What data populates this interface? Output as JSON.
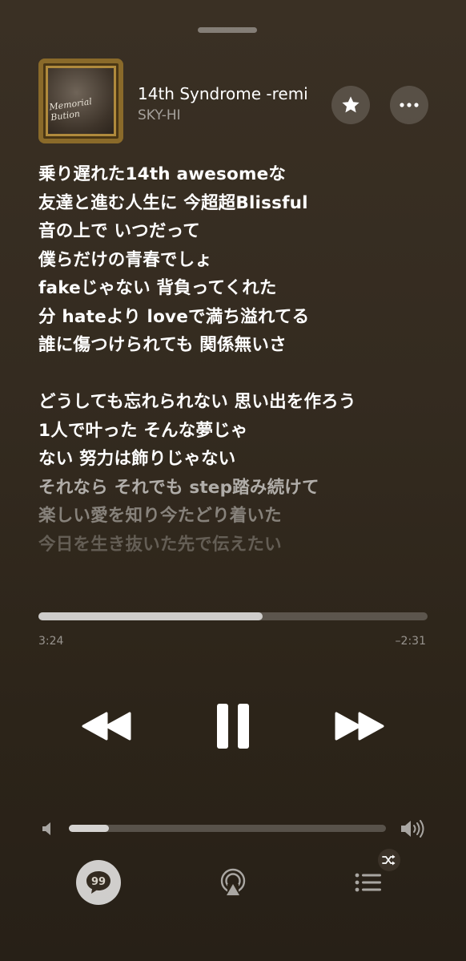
{
  "now_playing": {
    "title": "14th Syndrome -remi",
    "artist": "SKY-HI",
    "album_art_text": "Memorial Bution"
  },
  "lyrics": [
    {
      "text": "乗り遅れた14th awesomeな",
      "opacity": 1
    },
    {
      "text": "友達と進む人生に 今超超Blissful",
      "opacity": 1
    },
    {
      "text": "音の上で いつだって",
      "opacity": 1
    },
    {
      "text": "僕らだけの青春でしょ",
      "opacity": 1
    },
    {
      "text": "fakeじゃない 背負ってくれた",
      "opacity": 1
    },
    {
      "text": "分 hateより loveで満ち溢れてる",
      "opacity": 1
    },
    {
      "text": "誰に傷つけられても 関係無いさ",
      "opacity": 1
    },
    {
      "text": "",
      "opacity": 1
    },
    {
      "text": "どうしても忘れられない 思い出を作ろう",
      "opacity": 1
    },
    {
      "text": "1人で叶った そんな夢じゃ",
      "opacity": 1
    },
    {
      "text": "ない 努力は飾りじゃない",
      "opacity": 1
    },
    {
      "text": "それなら それでも step踏み続けて",
      "opacity": 0.62
    },
    {
      "text": "楽しい愛を知り今たどり着いた",
      "opacity": 0.42
    },
    {
      "text": "今日を生き抜いた先で伝えたい",
      "opacity": 0.25
    }
  ],
  "playback": {
    "elapsed": "3:24",
    "remaining": "–2:31",
    "progress_fraction": 0.576,
    "state": "playing"
  },
  "volume": {
    "level_fraction": 0.125
  },
  "icons": {
    "favorite": "star-icon",
    "more": "ellipsis-icon",
    "rewind": "rewind-icon",
    "pause": "pause-icon",
    "forward": "fast-forward-icon",
    "volume_low": "speaker-low-icon",
    "volume_high": "speaker-high-icon",
    "lyrics": "lyrics-quote-icon",
    "airplay": "airplay-icon",
    "queue": "queue-list-icon",
    "shuffle": "shuffle-icon"
  }
}
